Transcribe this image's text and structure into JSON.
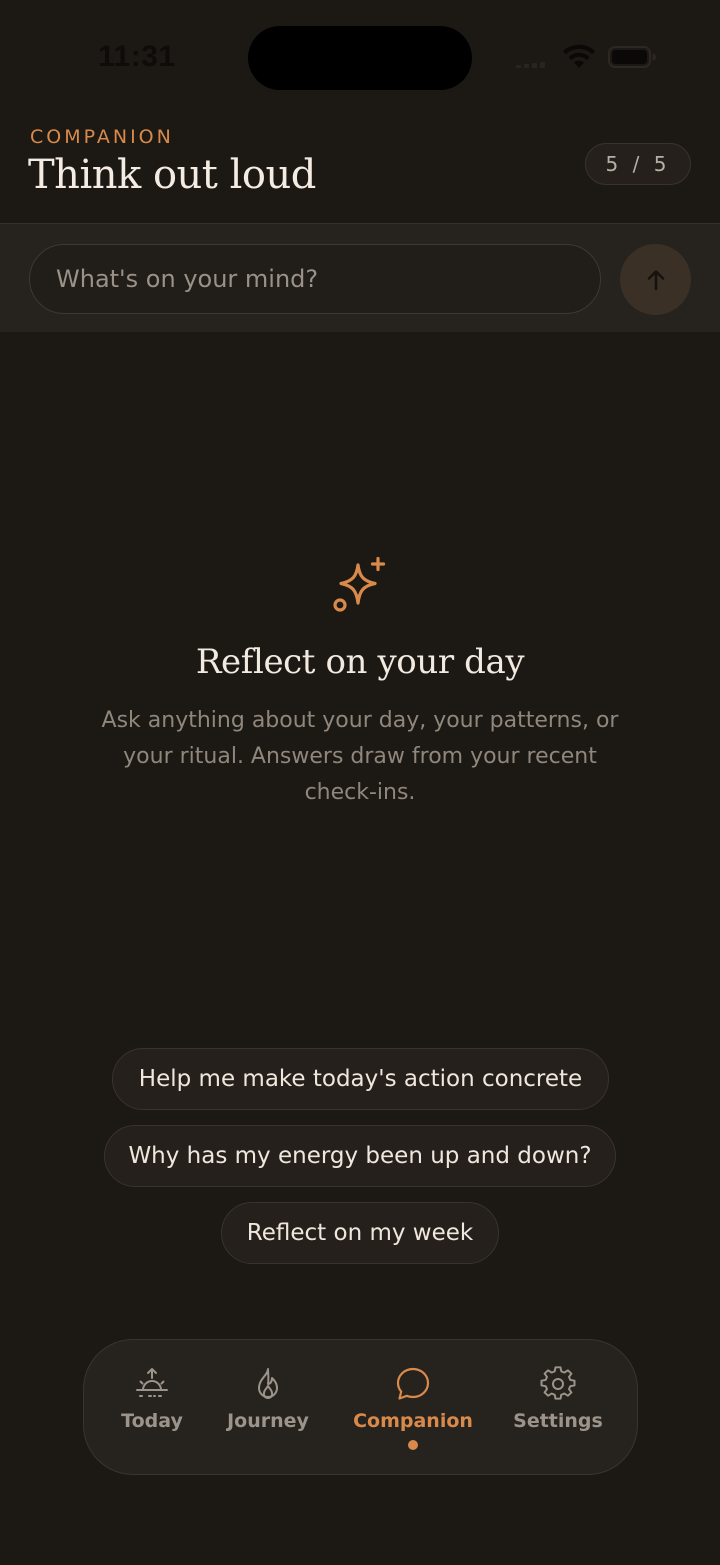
{
  "status_bar": {
    "time": "11:31"
  },
  "header": {
    "eyebrow": "COMPANION",
    "title": "Think out loud",
    "usage": "5 / 5"
  },
  "composer": {
    "placeholder": "What's on your mind?",
    "value": ""
  },
  "empty_state": {
    "icon": "sparkle-icon",
    "title": "Reflect on your day",
    "body": "Ask anything about your day, your patterns, or your ritual. Answers draw from your recent check-ins."
  },
  "suggestions": [
    "Help me make today's action concrete",
    "Why has my energy been up and down?",
    "Reflect on my week"
  ],
  "tabs": [
    {
      "label": "Today",
      "icon": "sunrise-icon",
      "active": false
    },
    {
      "label": "Journey",
      "icon": "flame-icon",
      "active": false
    },
    {
      "label": "Companion",
      "icon": "chat-bubble-icon",
      "active": true
    },
    {
      "label": "Settings",
      "icon": "gear-icon",
      "active": false
    }
  ],
  "colors": {
    "background": "#1c1814",
    "accent": "#d98a4a",
    "text_primary": "#f4ece2",
    "text_muted": "#8f867c"
  }
}
